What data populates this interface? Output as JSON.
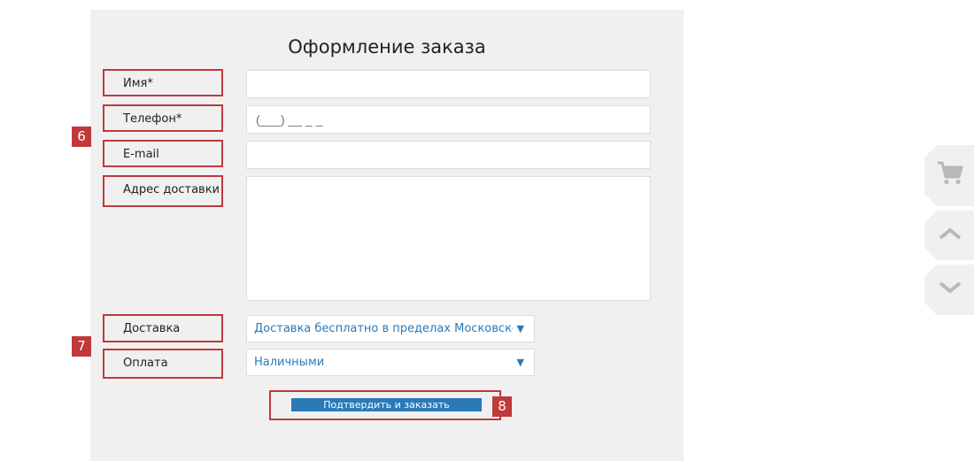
{
  "form": {
    "title": "Оформление заказа",
    "name_label": "Имя*",
    "phone_label": "Телефон*",
    "phone_placeholder": "(___) __ _ _",
    "email_label": "E-mail",
    "address_label": "Адрес доставки",
    "delivery_label": "Доставка",
    "delivery_value": "Доставка бесплатно в пределах Московской обл.",
    "payment_label": "Оплата",
    "payment_value": "Наличными",
    "submit_label": "Подтвердить и заказать"
  },
  "badges": {
    "six": "6",
    "seven": "7",
    "eight": "8"
  },
  "sidebar": {
    "icons": [
      "cart-icon",
      "chevron-up-icon",
      "chevron-down-icon"
    ]
  },
  "colors": {
    "highlight": "#c0393b",
    "accent": "#2a7ab8",
    "panel": "#f0f0f0",
    "icon": "#b8b8b8"
  }
}
